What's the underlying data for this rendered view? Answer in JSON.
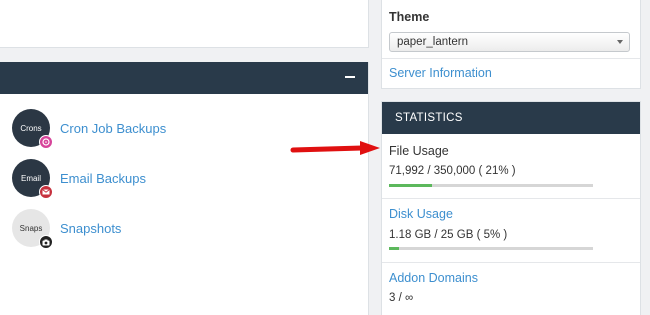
{
  "tools": {
    "items": [
      {
        "icon_label": "Crons",
        "link": "Cron Job Backups"
      },
      {
        "icon_label": "Email",
        "link": "Email Backups"
      },
      {
        "icon_label": "Snaps",
        "link": "Snapshots"
      }
    ]
  },
  "theme": {
    "label": "Theme",
    "selected": "paper_lantern",
    "server_info_link": "Server Information"
  },
  "statistics": {
    "title": "STATISTICS",
    "file_usage": {
      "label": "File Usage",
      "value": "71,992 / 350,000 ( 21% )",
      "percent": 21
    },
    "disk_usage": {
      "label": "Disk Usage",
      "value": "1.18 GB / 25 GB ( 5% )",
      "percent": 5
    },
    "addon_domains": {
      "label": "Addon Domains",
      "value": "3 / ∞"
    }
  },
  "colors": {
    "header_bg": "#293a4a",
    "link": "#3d8fcf",
    "progress": "#5cb85c",
    "arrow": "#e01010"
  }
}
